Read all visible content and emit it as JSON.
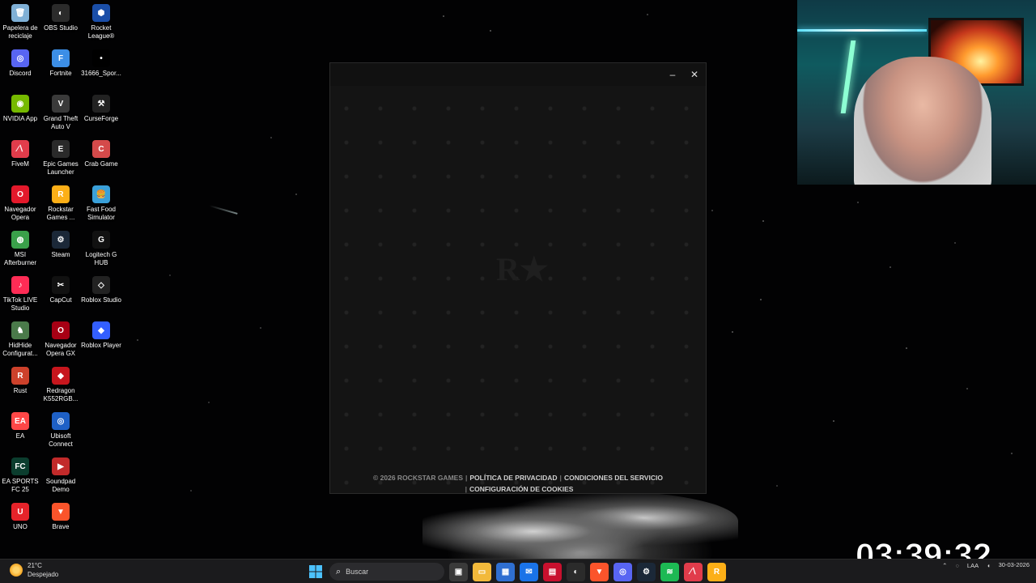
{
  "desktop_icons": [
    {
      "label": "Papelera de reciclaje",
      "icon": "recycle-bin-icon",
      "color": "#7fb0d6",
      "glyph": "🗑"
    },
    {
      "label": "Discord",
      "icon": "discord-icon",
      "color": "#5865f2",
      "glyph": "◎"
    },
    {
      "label": "NVIDIA App",
      "icon": "nvidia-icon",
      "color": "#76b900",
      "glyph": "◉"
    },
    {
      "label": "FiveM",
      "icon": "fivem-icon",
      "color": "#e13c4b",
      "glyph": "∕∖"
    },
    {
      "label": "Navegador Opera",
      "icon": "opera-icon",
      "color": "#e3192b",
      "glyph": "O"
    },
    {
      "label": "MSI Afterburner",
      "icon": "msi-afterburner-icon",
      "color": "#3aa04a",
      "glyph": "◍"
    },
    {
      "label": "TikTok LIVE Studio",
      "icon": "tiktok-live-icon",
      "color": "#fe2c55",
      "glyph": "♪"
    },
    {
      "label": "HidHide Configurat...",
      "icon": "hidhide-icon",
      "color": "#4a7a4a",
      "glyph": "♞"
    },
    {
      "label": "Rust",
      "icon": "rust-icon",
      "color": "#cd412b",
      "glyph": "R"
    },
    {
      "label": "EA",
      "icon": "ea-icon",
      "color": "#ff4747",
      "glyph": "EA"
    },
    {
      "label": "EA SPORTS FC 25",
      "icon": "ea-sports-fc-icon",
      "color": "#0b3d2e",
      "glyph": "FC"
    },
    {
      "label": "UNO",
      "icon": "uno-icon",
      "color": "#e6232a",
      "glyph": "U"
    },
    {
      "label": "OBS Studio",
      "icon": "obs-studio-icon",
      "color": "#2b2b2b",
      "glyph": "◐"
    },
    {
      "label": "Fortnite",
      "icon": "fortnite-icon",
      "color": "#3c8ee6",
      "glyph": "F"
    },
    {
      "label": "Grand Theft Auto V",
      "icon": "gta-v-icon",
      "color": "#3a3a3a",
      "glyph": "V"
    },
    {
      "label": "Epic Games Launcher",
      "icon": "epic-games-icon",
      "color": "#2a2a2a",
      "glyph": "E"
    },
    {
      "label": "Rockstar Games ...",
      "icon": "rockstar-games-icon",
      "color": "#fcaf17",
      "glyph": "R"
    },
    {
      "label": "Steam",
      "icon": "steam-icon",
      "color": "#1b2838",
      "glyph": "⚙"
    },
    {
      "label": "CapCut",
      "icon": "capcut-icon",
      "color": "#111111",
      "glyph": "✂"
    },
    {
      "label": "Navegador Opera GX",
      "icon": "opera-gx-icon",
      "color": "#a70014",
      "glyph": "O"
    },
    {
      "label": "Redragon K552RGB...",
      "icon": "redragon-icon",
      "color": "#c7161d",
      "glyph": "◆"
    },
    {
      "label": "Ubisoft Connect",
      "icon": "ubisoft-connect-icon",
      "color": "#1e60c6",
      "glyph": "◎"
    },
    {
      "label": "Soundpad Demo",
      "icon": "soundpad-icon",
      "color": "#c22a2a",
      "glyph": "▶"
    },
    {
      "label": "Brave",
      "icon": "brave-icon",
      "color": "#fb542b",
      "glyph": "▼"
    },
    {
      "label": "Rocket League®",
      "icon": "rocket-league-icon",
      "color": "#1a4ea8",
      "glyph": "⬢"
    },
    {
      "label": "31666_Spor...",
      "icon": "file-icon",
      "color": "#000000",
      "glyph": "•"
    },
    {
      "label": "CurseForge",
      "icon": "curseforge-icon",
      "color": "#222222",
      "glyph": "⚒"
    },
    {
      "label": "Crab Game",
      "icon": "crab-game-icon",
      "color": "#d44a4a",
      "glyph": "C"
    },
    {
      "label": "Fast Food Simulator",
      "icon": "fast-food-simulator-icon",
      "color": "#3aa0d9",
      "glyph": "🍔"
    },
    {
      "label": "Logitech G HUB",
      "icon": "logitech-g-hub-icon",
      "color": "#111111",
      "glyph": "G"
    },
    {
      "label": "Roblox Studio",
      "icon": "roblox-studio-icon",
      "color": "#222222",
      "glyph": "◇"
    },
    {
      "label": "Roblox Player",
      "icon": "roblox-player-icon",
      "color": "#335fff",
      "glyph": "◆"
    }
  ],
  "launcher": {
    "minimize": "–",
    "close": "✕",
    "logo": "R★",
    "copyright": "© 2026 ROCKSTAR GAMES",
    "privacy": "POLÍTICA DE PRIVACIDAD",
    "terms": "CONDICIONES DEL SERVICIO",
    "cookies": "CONFIGURACIÓN DE COOKIES",
    "sep": "|"
  },
  "overlay": {
    "time": "03:39:32"
  },
  "taskbar": {
    "weather_temp": "21°C",
    "weather_desc": "Despejado",
    "search_placeholder": "Buscar",
    "pinned": [
      {
        "icon": "task-view-icon",
        "color": "#3a3a3a",
        "glyph": "▣"
      },
      {
        "icon": "file-explorer-icon",
        "color": "#f2b93b",
        "glyph": "▭"
      },
      {
        "icon": "microsoft-store-icon",
        "color": "#2f6fd1",
        "glyph": "▦"
      },
      {
        "icon": "mail-icon",
        "color": "#1a73e8",
        "glyph": "✉"
      },
      {
        "icon": "news-icon",
        "color": "#c8102e",
        "glyph": "▤"
      },
      {
        "icon": "obs-studio-icon",
        "color": "#2b2b2b",
        "glyph": "◐"
      },
      {
        "icon": "brave-icon",
        "color": "#fb542b",
        "glyph": "▼"
      },
      {
        "icon": "discord-icon",
        "color": "#5865f2",
        "glyph": "◎"
      },
      {
        "icon": "steam-icon",
        "color": "#1b2838",
        "glyph": "⚙"
      },
      {
        "icon": "spotify-icon",
        "color": "#1db954",
        "glyph": "≋"
      },
      {
        "icon": "fivem-icon",
        "color": "#e13c4b",
        "glyph": "∕∖"
      },
      {
        "icon": "rockstar-games-icon",
        "color": "#fcaf17",
        "glyph": "R"
      }
    ],
    "lang": "LAA",
    "date": "30-03-2026"
  }
}
